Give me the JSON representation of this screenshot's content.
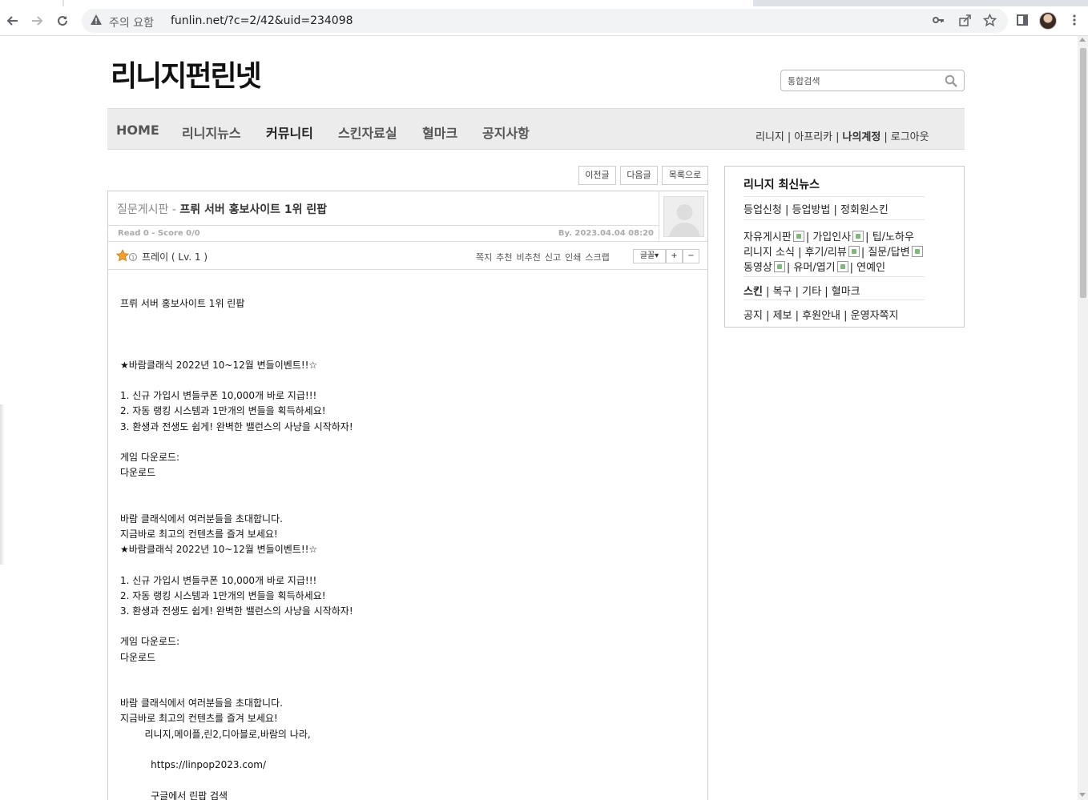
{
  "browser": {
    "security_label": "주의 요함",
    "url": "funlin.net/?c=2/42&uid=234098"
  },
  "site": {
    "logo": "리니지펀린넷",
    "search_placeholder": "통합검색"
  },
  "nav": {
    "menu": [
      "HOME",
      "리니지뉴스",
      "커뮤니티",
      "스킨자료실",
      "혈마크",
      "공지사항"
    ],
    "util": [
      "리니지",
      "아프리카",
      "나의계정",
      "로그아웃"
    ]
  },
  "post_buttons": [
    "이전글",
    "다음글",
    "목록으로"
  ],
  "post": {
    "board": "질문게시판 - ",
    "title": "프뤼 서버 홍보사이트 1위 린팝",
    "stats": "Read 0 - Score 0/0",
    "date": "By. 2023.04.04 08:20",
    "author": "프레이 ( Lv. 1 )",
    "actions": [
      "쪽지",
      "추천",
      "비추천",
      "신고",
      "인쇄",
      "스크랩"
    ],
    "font_btn": "글꼴▾",
    "plus_btn": "+",
    "minus_btn": "−",
    "body_lines": [
      "프뤼 서버 홍보사이트 1위 린팝",
      "",
      "",
      "",
      "★바람클래식 2022년 10~12월 변들이벤트!!☆",
      "",
      "1. 신규 가입시 변들쿠폰 10,000개 바로 지급!!!",
      "2. 자동 랭킹 시스템과 1만개의 변들을 획득하세요!",
      "3. 환생과 전생도 쉽게! 완벽한 밸런스의 사냥을 시작하자!",
      "",
      "게임 다운로드:",
      "다운로드",
      "",
      "",
      "바람 클래식에서 여러분들을 초대합니다.",
      "지금바로 최고의 컨텐츠를 즐겨 보세요!",
      "★바람클래식 2022년 10~12월 변들이벤트!!☆",
      "",
      "1. 신규 가입시 변들쿠폰 10,000개 바로 지급!!!",
      "2. 자동 랭킹 시스템과 1만개의 변들을 획득하세요!",
      "3. 환생과 전생도 쉽게! 완벽한 밸런스의 사냥을 시작하자!",
      "",
      "게임 다운로드:",
      "다운로드",
      "",
      "",
      "바람 클래식에서 여러분들을 초대합니다.",
      "지금바로 최고의 컨텐츠를 즐겨 보세요!",
      "        리니지,메이플,린2,디아블로,바람의 나라,",
      "",
      "          https://linpop2023.com/",
      "",
      "          구글에서 린팝 검색"
    ]
  },
  "sidebar": {
    "title": "리니지 최신뉴스",
    "row1": [
      "등업신청",
      "등업방법",
      "정회원스킨"
    ],
    "row2a": [
      "자유게시판",
      "가입인사",
      "팁/노하우"
    ],
    "row2b": [
      "리니지 소식",
      "후기/리뷰",
      "질문/답변"
    ],
    "row2c": [
      "동영상",
      "유머/엽기",
      "연예인"
    ],
    "row3": [
      "스킨",
      "복구",
      "기타",
      "혈마크"
    ],
    "row4": [
      "공지",
      "제보",
      "후원안내",
      "운영자쪽지"
    ]
  }
}
